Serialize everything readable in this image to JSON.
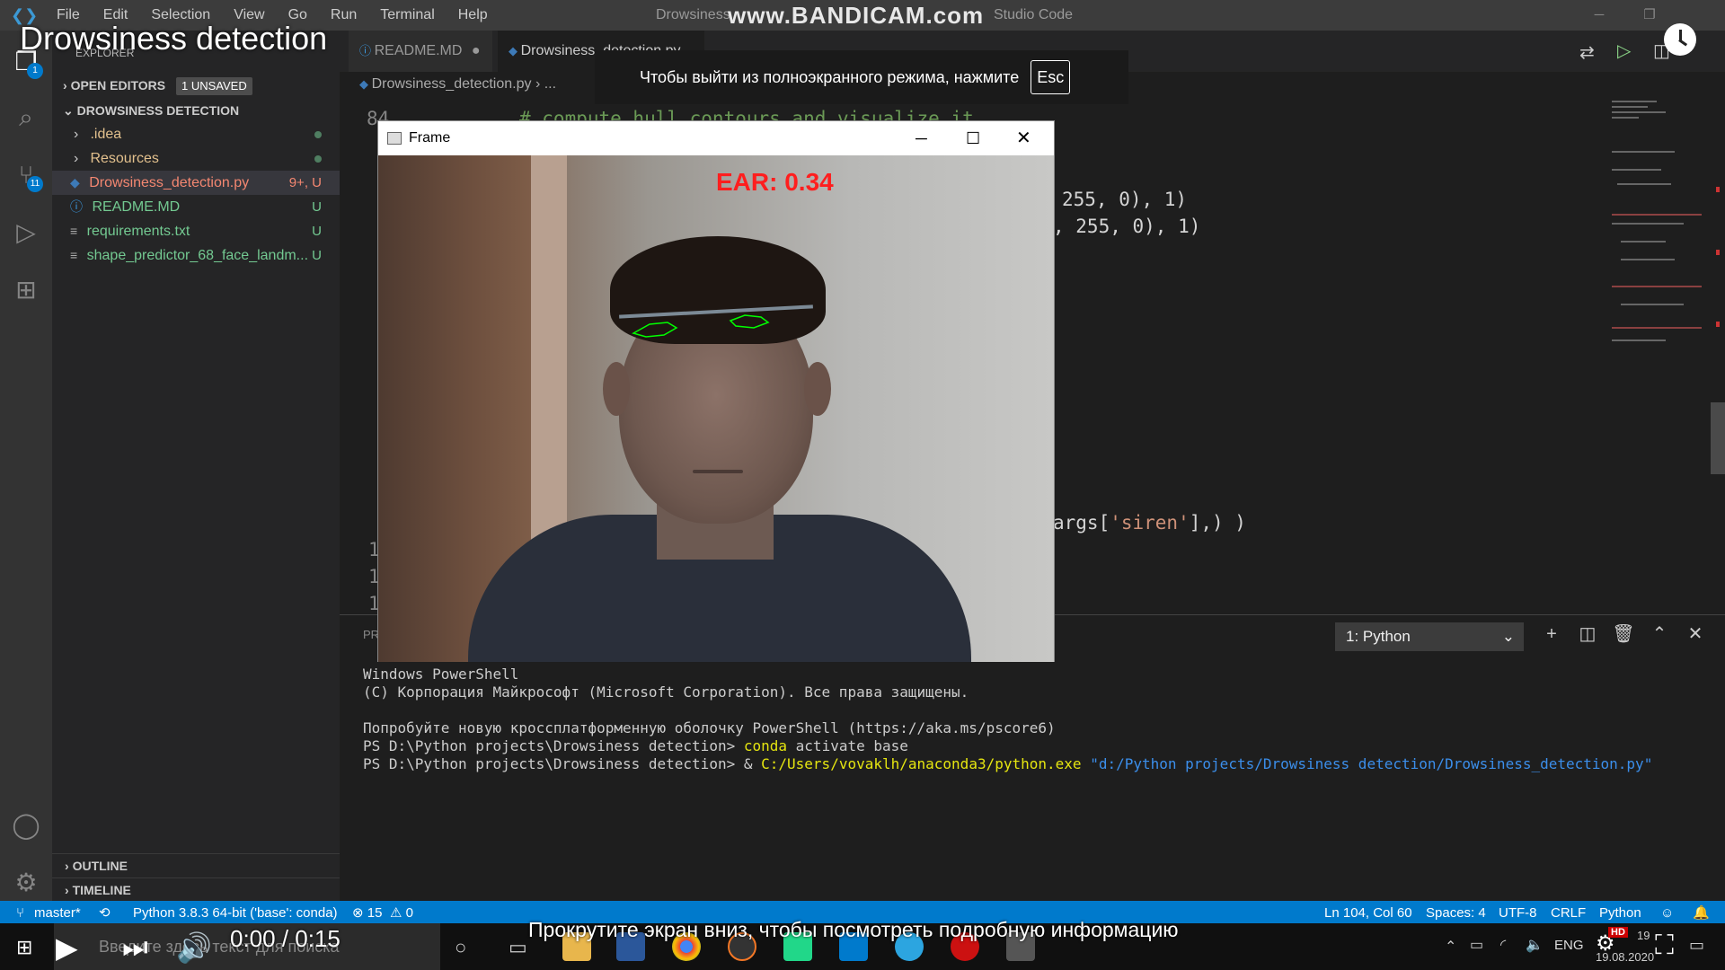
{
  "video": {
    "title": "Drowsiness detection",
    "time": "0:00 / 0:15",
    "scroll_hint": "Прокрутите экран вниз, чтобы посмотреть подробную информацию",
    "hd_badge": "HD"
  },
  "watermark": "www.BANDICAM.com",
  "window": {
    "title_left": "Drowsiness",
    "title_right": "Studio Code"
  },
  "menu": [
    "File",
    "Edit",
    "Selection",
    "View",
    "Go",
    "Run",
    "Terminal",
    "Help"
  ],
  "fullscreen_notice": {
    "text": "Чтобы выйти из полноэкранного режима, нажмите",
    "key": "Esc"
  },
  "activity": {
    "explorer_badge": "1",
    "scm_badge": "11"
  },
  "sidebar": {
    "header": "EXPLORER",
    "open_editors": "OPEN EDITORS",
    "unsaved": "1 UNSAVED",
    "project": "DROWSINESS DETECTION",
    "items": [
      {
        "label": ".idea",
        "status": ""
      },
      {
        "label": "Resources",
        "status": ""
      },
      {
        "label": "Drowsiness_detection.py",
        "status": "9+, U"
      },
      {
        "label": "README.MD",
        "status": "U"
      },
      {
        "label": "requirements.txt",
        "status": "U"
      },
      {
        "label": "shape_predictor_68_face_landm...",
        "status": "U"
      }
    ],
    "outline": "OUTLINE",
    "timeline": "TIMELINE"
  },
  "tabs": [
    {
      "label": "README.MD",
      "dirty": "●"
    },
    {
      "label": "Drowsiness_detection.py",
      "close": "✕"
    }
  ],
  "breadcrumb": {
    "file": "Drowsiness_detection.py",
    "more": "..."
  },
  "editor": {
    "line_top": "84",
    "comment": "# compute hull contours and visualize it",
    "code1": "255, 0), 1)",
    "code2": ", 255, 0), 1)",
    "code3_a": "args[",
    "code3_str": "'siren'",
    "code3_b": "],) )",
    "lnums": [
      "1",
      "1",
      "1"
    ]
  },
  "frame": {
    "title": "Frame",
    "ear": "EAR: 0.34"
  },
  "panel": {
    "tab_partial": "PR",
    "terminal_select": "1: Python",
    "lines": [
      "Windows PowerShell",
      "(C) Корпорация Майкрософт (Microsoft Corporation). Все права защищены.",
      "",
      "Попробуйте новую кроссплатформенную оболочку PowerShell (https://aka.ms/pscore6)"
    ],
    "prompt": "PS D:\\Python projects\\Drowsiness detection>",
    "cmd1": "conda",
    "cmd1_rest": " activate base",
    "cmd2_amp": " &",
    "cmd2_exe": "C:/Users/vovaklh/anaconda3/python.exe",
    "cmd2_arg": "\"d:/Python projects/Drowsiness detection/Drowsiness_detection.py\""
  },
  "statusbar": {
    "branch": "master*",
    "python": "Python 3.8.3 64-bit ('base': conda)",
    "errors": "⊗ 15",
    "warnings": "⚠ 0",
    "position": "Ln 104, Col 60",
    "spaces": "Spaces: 4",
    "encoding": "UTF-8",
    "eol": "CRLF",
    "language": "Python"
  },
  "taskbar": {
    "search_placeholder": "Введите здесь текст для поиска",
    "lang": "ENG",
    "date": "19.08.2020",
    "time_partial": "19"
  },
  "colors": {
    "accent": "#007acc",
    "ear": "#ff1e1e",
    "eye_contour": "#00ff00"
  }
}
